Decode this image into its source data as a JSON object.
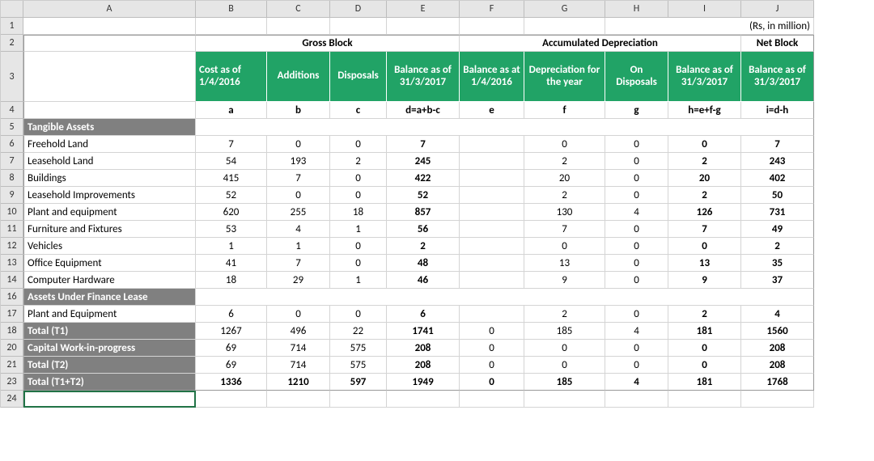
{
  "columns": [
    "A",
    "B",
    "C",
    "D",
    "E",
    "F",
    "G",
    "H",
    "I",
    "J"
  ],
  "rowLabels": [
    "1",
    "2",
    "3",
    "4",
    "5",
    "6",
    "7",
    "8",
    "9",
    "10",
    "11",
    "12",
    "13",
    "14",
    "16",
    "17",
    "18",
    "20",
    "21",
    "23",
    "24"
  ],
  "unitNote": "(Rs, in million)",
  "groupHeaders": {
    "gross": "Gross Block",
    "accdep": "Accumulated Depreciation",
    "net": "Net Block"
  },
  "colHeaders": {
    "b": "Cost as of 1/4/2016",
    "c": "Additions",
    "d": "Disposals",
    "e": "Balance as of 31/3/2017",
    "f": "Balance as at 1/4/2016",
    "g": "Depreciation for the year",
    "h": "On Disposals",
    "i": "Balance as of 31/3/2017",
    "j": "Balance as of 31/3/2017"
  },
  "formulaRow": {
    "b": "a",
    "c": "b",
    "d": "c",
    "e": "d=a+b-c",
    "f": "e",
    "g": "f",
    "h": "g",
    "i": "h=e+f-g",
    "j": "i=d-h"
  },
  "sections": {
    "tangible": "Tangible Assets",
    "finlease": "Assets Under Finance Lease",
    "cwip": "Capital Work-in-progress"
  },
  "rows": [
    {
      "label": "Freehold Land",
      "b": "7",
      "c": "0",
      "d": "0",
      "e": "7",
      "f": "",
      "g": "0",
      "h": "0",
      "i": "0",
      "j": "7"
    },
    {
      "label": "Leasehold Land",
      "b": "54",
      "c": "193",
      "d": "2",
      "e": "245",
      "f": "",
      "g": "2",
      "h": "0",
      "i": "2",
      "j": "243"
    },
    {
      "label": "Buildings",
      "b": "415",
      "c": "7",
      "d": "0",
      "e": "422",
      "f": "",
      "g": "20",
      "h": "0",
      "i": "20",
      "j": "402"
    },
    {
      "label": "Leasehold Improvements",
      "b": "52",
      "c": "0",
      "d": "0",
      "e": "52",
      "f": "",
      "g": "2",
      "h": "0",
      "i": "2",
      "j": "50"
    },
    {
      "label": "Plant and equipment",
      "b": "620",
      "c": "255",
      "d": "18",
      "e": "857",
      "f": "",
      "g": "130",
      "h": "4",
      "i": "126",
      "j": "731"
    },
    {
      "label": "Furniture and Fixtures",
      "b": "53",
      "c": "4",
      "d": "1",
      "e": "56",
      "f": "",
      "g": "7",
      "h": "0",
      "i": "7",
      "j": "49"
    },
    {
      "label": "Vehicles",
      "b": "1",
      "c": "1",
      "d": "0",
      "e": "2",
      "f": "",
      "g": "0",
      "h": "0",
      "i": "0",
      "j": "2"
    },
    {
      "label": "Office Equipment",
      "b": "41",
      "c": "7",
      "d": "0",
      "e": "48",
      "f": "",
      "g": "13",
      "h": "0",
      "i": "13",
      "j": "35"
    },
    {
      "label": "Computer Hardware",
      "b": "18",
      "c": "29",
      "d": "1",
      "e": "46",
      "f": "",
      "g": "9",
      "h": "0",
      "i": "9",
      "j": "37"
    }
  ],
  "finleaseRow": {
    "label": "Plant and Equipment",
    "b": "6",
    "c": "0",
    "d": "0",
    "e": "6",
    "f": "",
    "g": "2",
    "h": "0",
    "i": "2",
    "j": "4"
  },
  "totals": {
    "t1": {
      "label": "Total (T1)",
      "b": "1267",
      "c": "496",
      "d": "22",
      "e": "1741",
      "f": "0",
      "g": "185",
      "h": "4",
      "i": "181",
      "j": "1560"
    },
    "cwip": {
      "b": "69",
      "c": "714",
      "d": "575",
      "e": "208",
      "f": "0",
      "g": "0",
      "h": "0",
      "i": "0",
      "j": "208"
    },
    "t2": {
      "label": "Total (T2)",
      "b": "69",
      "c": "714",
      "d": "575",
      "e": "208",
      "f": "0",
      "g": "0",
      "h": "0",
      "i": "0",
      "j": "208"
    },
    "t12": {
      "label": "Total (T1+T2)",
      "b": "1336",
      "c": "1210",
      "d": "597",
      "e": "1949",
      "f": "0",
      "g": "185",
      "h": "4",
      "i": "181",
      "j": "1768"
    }
  },
  "chart_data": {
    "type": "table",
    "title": "Fixed Assets Schedule (Rs, in million)",
    "columns": [
      "Cost as of 1/4/2016",
      "Additions",
      "Disposals",
      "Balance 31/3/2017 (Gross)",
      "Balance 1/4/2016 (AccDep)",
      "Depreciation for year",
      "On Disposals",
      "Balance 31/3/2017 (AccDep)",
      "Net Block 31/3/2017"
    ],
    "rows": [
      [
        "Freehold Land",
        7,
        0,
        0,
        7,
        null,
        0,
        0,
        0,
        7
      ],
      [
        "Leasehold Land",
        54,
        193,
        2,
        245,
        null,
        2,
        0,
        2,
        243
      ],
      [
        "Buildings",
        415,
        7,
        0,
        422,
        null,
        20,
        0,
        20,
        402
      ],
      [
        "Leasehold Improvements",
        52,
        0,
        0,
        52,
        null,
        2,
        0,
        2,
        50
      ],
      [
        "Plant and equipment",
        620,
        255,
        18,
        857,
        null,
        130,
        4,
        126,
        731
      ],
      [
        "Furniture and Fixtures",
        53,
        4,
        1,
        56,
        null,
        7,
        0,
        7,
        49
      ],
      [
        "Vehicles",
        1,
        1,
        0,
        2,
        null,
        0,
        0,
        0,
        2
      ],
      [
        "Office Equipment",
        41,
        7,
        0,
        48,
        null,
        13,
        0,
        13,
        35
      ],
      [
        "Computer Hardware",
        18,
        29,
        1,
        46,
        null,
        9,
        0,
        9,
        37
      ],
      [
        "Plant and Equipment (Finance Lease)",
        6,
        0,
        0,
        6,
        null,
        2,
        0,
        2,
        4
      ],
      [
        "Total (T1)",
        1267,
        496,
        22,
        1741,
        0,
        185,
        4,
        181,
        1560
      ],
      [
        "Capital Work-in-progress",
        69,
        714,
        575,
        208,
        0,
        0,
        0,
        0,
        208
      ],
      [
        "Total (T2)",
        69,
        714,
        575,
        208,
        0,
        0,
        0,
        0,
        208
      ],
      [
        "Total (T1+T2)",
        1336,
        1210,
        597,
        1949,
        0,
        185,
        4,
        181,
        1768
      ]
    ]
  }
}
